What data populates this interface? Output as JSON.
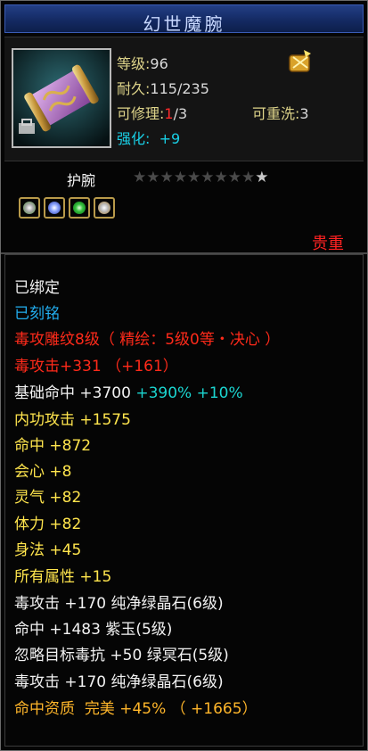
{
  "item": {
    "name": "幻世魔腕",
    "level_label": "等级",
    "level_value": "96",
    "durability_label": "耐久",
    "durability_value": "115/235",
    "repair_label": "可修理",
    "repair_used": "1",
    "repair_total": "/3",
    "rewash_label": "可重洗",
    "rewash_value": "3",
    "enhance_label": "强化",
    "enhance_value": "+9",
    "slot_type": "护腕",
    "stars_total": 9,
    "stars_lit": 1,
    "quality": "贵重"
  },
  "gems": [
    "white-gem-icon",
    "blue-gem-icon",
    "green-gem-icon",
    "yellow-gem-icon"
  ],
  "colors": {
    "red": "#ff2a1a",
    "blue": "#22aef0",
    "cyan": "#1bd5d0",
    "orange": "#ffb62a",
    "yellow": "#ffe54d"
  },
  "attributes": {
    "bound": "已绑定",
    "engraved": "已刻铭",
    "carve_line": "毒攻雕纹8级（ 精绘：5级0等・决心 ）",
    "poison_attack_label": "毒攻击",
    "poison_attack_value": "+331",
    "poison_attack_bonus": "（+161）",
    "base_hit_label": "基础命中",
    "base_hit_value": "+3700",
    "base_hit_pct1": "+390%",
    "base_hit_pct2": "+10%",
    "internal_attack_label": "内功攻击",
    "internal_attack_value": "+1575",
    "hit_label": "命中",
    "hit_value": "+872",
    "crit_label": "会心",
    "crit_value": "+8",
    "spirit_label": "灵气",
    "spirit_value": "+82",
    "stamina_label": "体力",
    "stamina_value": "+82",
    "agility_label": "身法",
    "agility_value": "+45",
    "all_label": "所有属性",
    "all_value": "+15",
    "gem_lines": [
      {
        "label": "毒攻击",
        "value": "+170",
        "gem": "纯净绿晶石",
        "level": "(6级)"
      },
      {
        "label": "命中",
        "value": "+1483",
        "gem": "紫玉",
        "level": "(5级)"
      },
      {
        "label": "忽略目标毒抗",
        "value": "+50",
        "gem": "绿冥石",
        "level": "(5级)"
      },
      {
        "label": "毒攻击",
        "value": "+170",
        "gem": "纯净绿晶石",
        "level": "(6级)"
      }
    ],
    "aptitude_label": "命中资质",
    "aptitude_grade": "完美",
    "aptitude_pct": "+45%",
    "aptitude_bonus": "（ +1665）"
  }
}
